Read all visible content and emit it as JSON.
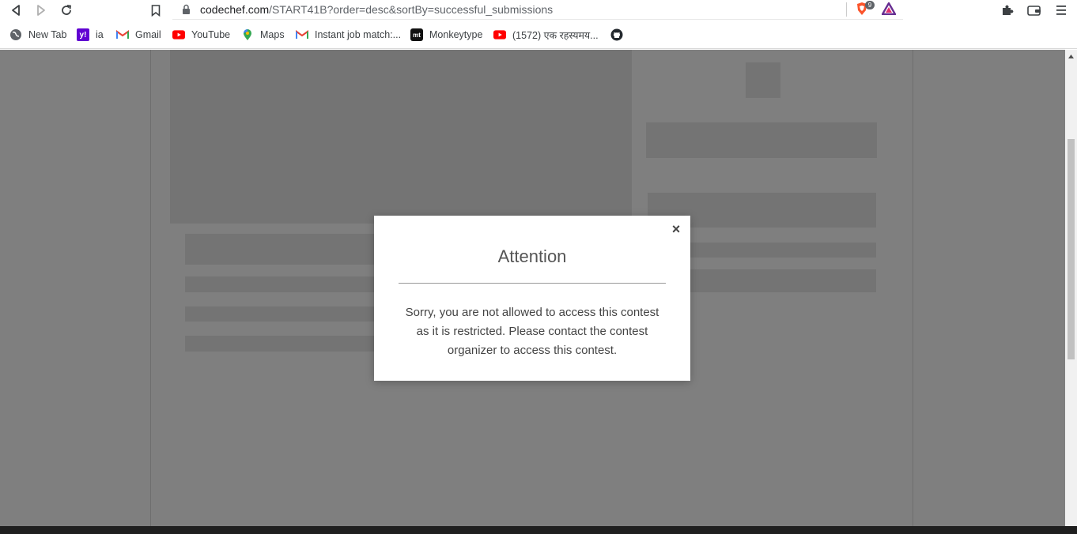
{
  "browser": {
    "url_host": "codechef.com",
    "url_path": "/START41B?order=desc&sortBy=successful_submissions",
    "brave_shield_count": "9"
  },
  "bookmarks": [
    {
      "label": "New Tab",
      "icon": "globe-icon"
    },
    {
      "label": "ia",
      "icon": "yahoo-icon"
    },
    {
      "label": "Gmail",
      "icon": "gmail-icon"
    },
    {
      "label": "YouTube",
      "icon": "youtube-icon"
    },
    {
      "label": "Maps",
      "icon": "maps-icon"
    },
    {
      "label": "Instant job match:...",
      "icon": "gmail-icon"
    },
    {
      "label": "Monkeytype",
      "icon": "monkeytype-icon"
    },
    {
      "label": "(1572) एक रहस्यमय...",
      "icon": "youtube-icon"
    },
    {
      "label": "",
      "icon": "github-icon"
    }
  ],
  "modal": {
    "title": "Attention",
    "body": "Sorry, you are not allowed to access this contest as it is restricted. Please contact the contest organizer to access this contest.",
    "close_symbol": "×"
  },
  "colors": {
    "overlay": "rgba(0,0,0,0.5)",
    "youtube_red": "#ff0000",
    "yahoo_purple": "#6001d2"
  }
}
